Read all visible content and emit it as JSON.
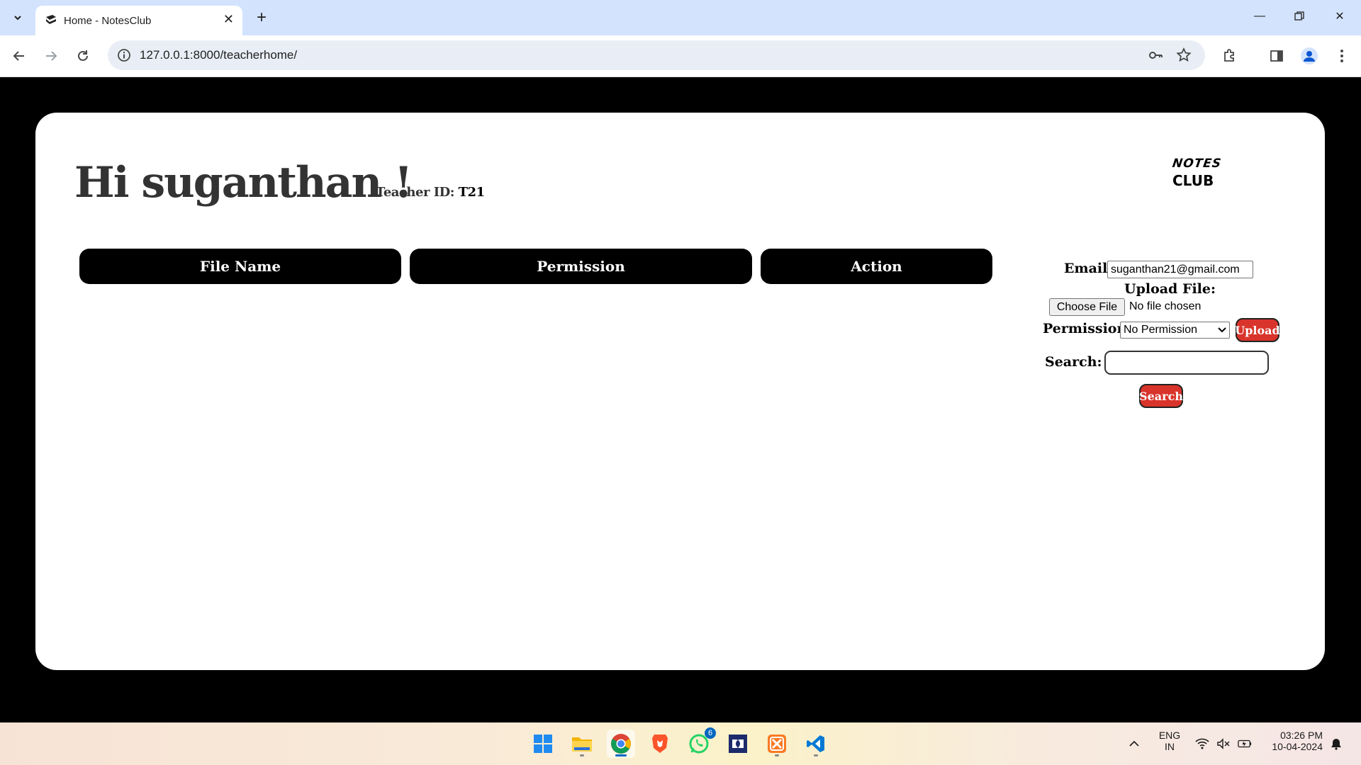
{
  "browser": {
    "tab_title": "Home - NotesClub",
    "url": "127.0.0.1:8000/teacherhome/"
  },
  "page": {
    "greeting": "Hi suganthan !",
    "teacher_id_label": "Teacher ID:",
    "teacher_id_value": "T21",
    "logo_top": "NOTES",
    "logo_bottom": "CLUB",
    "table_headers": [
      "File Name",
      "Permission",
      "Action"
    ],
    "form": {
      "email_label": "Email:",
      "email_value": "suganthan21@gmail.com",
      "upload_file_label": "Upload File:",
      "choose_file_label": "Choose File",
      "file_status": "No file chosen",
      "permission_label": "Permission:",
      "permission_selected": "No Permission",
      "upload_button": "Upload",
      "search_label": "Search:",
      "search_value": "",
      "search_button": "Search"
    },
    "colors": {
      "background": "#000000",
      "card": "#ffffff",
      "header_pill": "#000000",
      "button_red": "#d9342b"
    }
  },
  "taskbar": {
    "apps": [
      "start-icon",
      "file-explorer-icon",
      "chrome-icon",
      "brave-icon",
      "whatsapp-icon",
      "dolby-access-icon",
      "xampp-icon",
      "vscode-icon"
    ],
    "whatsapp_badge": "6",
    "lang_line1": "ENG",
    "lang_line2": "IN",
    "time": "03:26 PM",
    "date": "10-04-2024"
  }
}
